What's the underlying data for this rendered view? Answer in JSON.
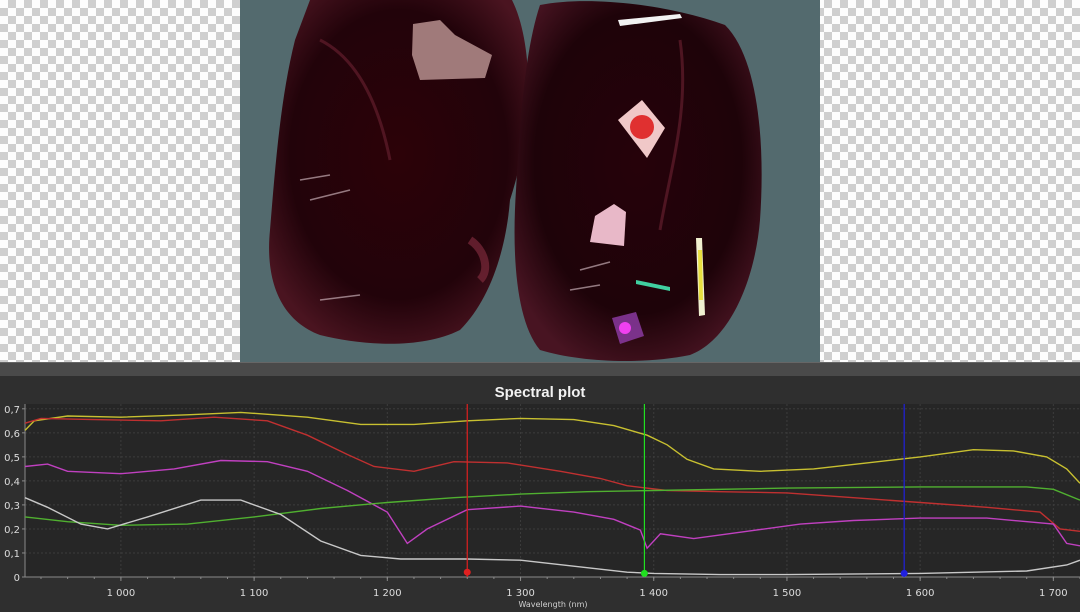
{
  "plot_panel": {
    "title": "Spectral plot"
  },
  "chart_data": {
    "type": "line",
    "title": "Spectral plot",
    "xlabel": "Wavelength (nm)",
    "ylabel": "",
    "xlim": [
      928,
      1720
    ],
    "ylim": [
      0,
      0.72
    ],
    "x_ticks": [
      {
        "v": 1000,
        "label": "1 000"
      },
      {
        "v": 1100,
        "label": "1 100"
      },
      {
        "v": 1200,
        "label": "1 200"
      },
      {
        "v": 1300,
        "label": "1 300"
      },
      {
        "v": 1400,
        "label": "1 400"
      },
      {
        "v": 1500,
        "label": "1 500"
      },
      {
        "v": 1600,
        "label": "1 600"
      },
      {
        "v": 1700,
        "label": "1 700"
      }
    ],
    "y_ticks": [
      {
        "v": 0,
        "label": "0"
      },
      {
        "v": 0.1,
        "label": "0,1"
      },
      {
        "v": 0.2,
        "label": "0,2"
      },
      {
        "v": 0.3,
        "label": "0,3"
      },
      {
        "v": 0.4,
        "label": "0,4"
      },
      {
        "v": 0.5,
        "label": "0,5"
      },
      {
        "v": 0.6,
        "label": "0,6"
      },
      {
        "v": 0.7,
        "label": "0,7"
      }
    ],
    "grid": true,
    "series": [
      {
        "color": "#c8c030",
        "points": [
          [
            928,
            0.61
          ],
          [
            935,
            0.65
          ],
          [
            960,
            0.67
          ],
          [
            1000,
            0.665
          ],
          [
            1050,
            0.675
          ],
          [
            1090,
            0.685
          ],
          [
            1140,
            0.665
          ],
          [
            1180,
            0.635
          ],
          [
            1220,
            0.635
          ],
          [
            1260,
            0.65
          ],
          [
            1300,
            0.66
          ],
          [
            1340,
            0.655
          ],
          [
            1370,
            0.63
          ],
          [
            1395,
            0.59
          ],
          [
            1410,
            0.55
          ],
          [
            1425,
            0.49
          ],
          [
            1445,
            0.45
          ],
          [
            1480,
            0.44
          ],
          [
            1520,
            0.45
          ],
          [
            1560,
            0.475
          ],
          [
            1600,
            0.5
          ],
          [
            1640,
            0.53
          ],
          [
            1670,
            0.525
          ],
          [
            1695,
            0.5
          ],
          [
            1710,
            0.45
          ],
          [
            1720,
            0.39
          ]
        ]
      },
      {
        "color": "#c03030",
        "points": [
          [
            928,
            0.64
          ],
          [
            940,
            0.66
          ],
          [
            980,
            0.655
          ],
          [
            1030,
            0.65
          ],
          [
            1070,
            0.665
          ],
          [
            1110,
            0.65
          ],
          [
            1140,
            0.59
          ],
          [
            1170,
            0.51
          ],
          [
            1190,
            0.46
          ],
          [
            1220,
            0.44
          ],
          [
            1250,
            0.48
          ],
          [
            1290,
            0.475
          ],
          [
            1330,
            0.44
          ],
          [
            1360,
            0.41
          ],
          [
            1380,
            0.38
          ],
          [
            1410,
            0.36
          ],
          [
            1450,
            0.355
          ],
          [
            1500,
            0.35
          ],
          [
            1550,
            0.33
          ],
          [
            1600,
            0.31
          ],
          [
            1650,
            0.29
          ],
          [
            1690,
            0.27
          ],
          [
            1705,
            0.2
          ],
          [
            1720,
            0.19
          ]
        ]
      },
      {
        "color": "#c040c0",
        "points": [
          [
            928,
            0.46
          ],
          [
            945,
            0.47
          ],
          [
            960,
            0.44
          ],
          [
            1000,
            0.43
          ],
          [
            1040,
            0.45
          ],
          [
            1075,
            0.485
          ],
          [
            1110,
            0.48
          ],
          [
            1140,
            0.44
          ],
          [
            1170,
            0.36
          ],
          [
            1200,
            0.27
          ],
          [
            1215,
            0.14
          ],
          [
            1230,
            0.2
          ],
          [
            1260,
            0.28
          ],
          [
            1300,
            0.295
          ],
          [
            1340,
            0.27
          ],
          [
            1370,
            0.24
          ],
          [
            1390,
            0.195
          ],
          [
            1395,
            0.12
          ],
          [
            1405,
            0.18
          ],
          [
            1430,
            0.16
          ],
          [
            1470,
            0.19
          ],
          [
            1510,
            0.22
          ],
          [
            1550,
            0.235
          ],
          [
            1600,
            0.245
          ],
          [
            1650,
            0.245
          ],
          [
            1700,
            0.22
          ],
          [
            1710,
            0.14
          ],
          [
            1720,
            0.13
          ]
        ]
      },
      {
        "color": "#50b030",
        "points": [
          [
            928,
            0.25
          ],
          [
            960,
            0.23
          ],
          [
            1000,
            0.215
          ],
          [
            1050,
            0.22
          ],
          [
            1100,
            0.25
          ],
          [
            1150,
            0.285
          ],
          [
            1200,
            0.31
          ],
          [
            1250,
            0.33
          ],
          [
            1300,
            0.345
          ],
          [
            1350,
            0.355
          ],
          [
            1400,
            0.36
          ],
          [
            1500,
            0.37
          ],
          [
            1600,
            0.375
          ],
          [
            1680,
            0.375
          ],
          [
            1700,
            0.365
          ],
          [
            1720,
            0.32
          ]
        ]
      },
      {
        "color": "#c8c8c8",
        "points": [
          [
            928,
            0.33
          ],
          [
            945,
            0.29
          ],
          [
            970,
            0.22
          ],
          [
            990,
            0.2
          ],
          [
            1020,
            0.25
          ],
          [
            1060,
            0.32
          ],
          [
            1090,
            0.32
          ],
          [
            1120,
            0.26
          ],
          [
            1150,
            0.15
          ],
          [
            1180,
            0.09
          ],
          [
            1210,
            0.075
          ],
          [
            1260,
            0.075
          ],
          [
            1300,
            0.07
          ],
          [
            1340,
            0.045
          ],
          [
            1380,
            0.02
          ],
          [
            1400,
            0.015
          ],
          [
            1450,
            0.01
          ],
          [
            1500,
            0.01
          ],
          [
            1600,
            0.015
          ],
          [
            1680,
            0.025
          ],
          [
            1710,
            0.05
          ],
          [
            1720,
            0.07
          ]
        ]
      }
    ],
    "markers": [
      {
        "x": 1260,
        "y": 0.02,
        "color": "#e02020"
      },
      {
        "x": 1393,
        "y": 0.015,
        "color": "#20e020"
      },
      {
        "x": 1588,
        "y": 0.015,
        "color": "#2020e0"
      }
    ]
  }
}
